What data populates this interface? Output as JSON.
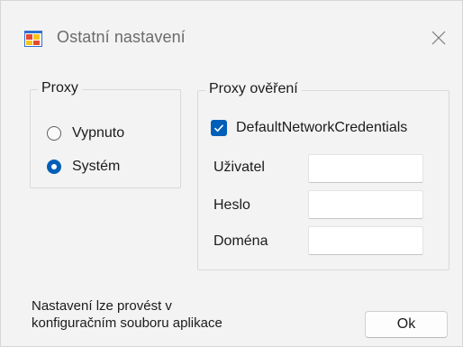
{
  "window": {
    "title": "Ostatní nastavení",
    "icon": "app-window-icon",
    "close_icon": "close-icon"
  },
  "proxy": {
    "legend": "Proxy",
    "options": [
      {
        "label": "Vypnuto",
        "selected": false
      },
      {
        "label": "Systém",
        "selected": true
      }
    ]
  },
  "auth": {
    "legend": "Proxy ověření",
    "default_credentials": {
      "label": "DefaultNetworkCredentials",
      "checked": true
    },
    "fields": [
      {
        "label": "Uživatel",
        "value": ""
      },
      {
        "label": "Heslo",
        "value": ""
      },
      {
        "label": "Doména",
        "value": ""
      }
    ]
  },
  "note": {
    "line1": "Nastavení lze provést v",
    "line2": "konfiguračním souboru aplikace"
  },
  "ok_label": "Ok",
  "colors": {
    "accent": "#005fb8",
    "window_bg": "#f3f3f3"
  }
}
